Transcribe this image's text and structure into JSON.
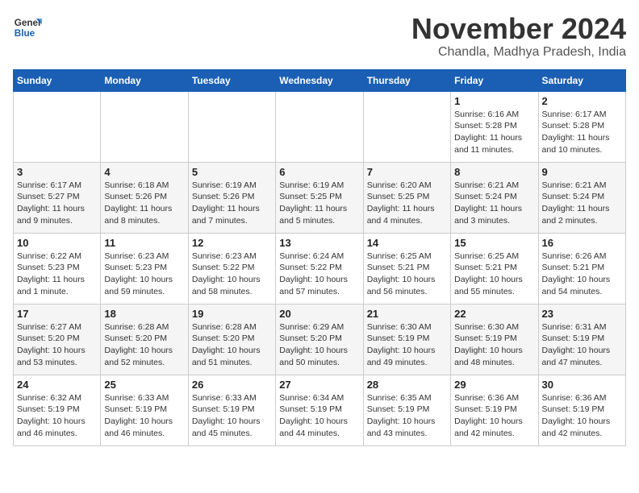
{
  "header": {
    "logo_line1": "General",
    "logo_line2": "Blue",
    "month_title": "November 2024",
    "location": "Chandla, Madhya Pradesh, India"
  },
  "days_of_week": [
    "Sunday",
    "Monday",
    "Tuesday",
    "Wednesday",
    "Thursday",
    "Friday",
    "Saturday"
  ],
  "weeks": [
    [
      {
        "day": "",
        "info": ""
      },
      {
        "day": "",
        "info": ""
      },
      {
        "day": "",
        "info": ""
      },
      {
        "day": "",
        "info": ""
      },
      {
        "day": "",
        "info": ""
      },
      {
        "day": "1",
        "info": "Sunrise: 6:16 AM\nSunset: 5:28 PM\nDaylight: 11 hours and 11 minutes."
      },
      {
        "day": "2",
        "info": "Sunrise: 6:17 AM\nSunset: 5:28 PM\nDaylight: 11 hours and 10 minutes."
      }
    ],
    [
      {
        "day": "3",
        "info": "Sunrise: 6:17 AM\nSunset: 5:27 PM\nDaylight: 11 hours and 9 minutes."
      },
      {
        "day": "4",
        "info": "Sunrise: 6:18 AM\nSunset: 5:26 PM\nDaylight: 11 hours and 8 minutes."
      },
      {
        "day": "5",
        "info": "Sunrise: 6:19 AM\nSunset: 5:26 PM\nDaylight: 11 hours and 7 minutes."
      },
      {
        "day": "6",
        "info": "Sunrise: 6:19 AM\nSunset: 5:25 PM\nDaylight: 11 hours and 5 minutes."
      },
      {
        "day": "7",
        "info": "Sunrise: 6:20 AM\nSunset: 5:25 PM\nDaylight: 11 hours and 4 minutes."
      },
      {
        "day": "8",
        "info": "Sunrise: 6:21 AM\nSunset: 5:24 PM\nDaylight: 11 hours and 3 minutes."
      },
      {
        "day": "9",
        "info": "Sunrise: 6:21 AM\nSunset: 5:24 PM\nDaylight: 11 hours and 2 minutes."
      }
    ],
    [
      {
        "day": "10",
        "info": "Sunrise: 6:22 AM\nSunset: 5:23 PM\nDaylight: 11 hours and 1 minute."
      },
      {
        "day": "11",
        "info": "Sunrise: 6:23 AM\nSunset: 5:23 PM\nDaylight: 10 hours and 59 minutes."
      },
      {
        "day": "12",
        "info": "Sunrise: 6:23 AM\nSunset: 5:22 PM\nDaylight: 10 hours and 58 minutes."
      },
      {
        "day": "13",
        "info": "Sunrise: 6:24 AM\nSunset: 5:22 PM\nDaylight: 10 hours and 57 minutes."
      },
      {
        "day": "14",
        "info": "Sunrise: 6:25 AM\nSunset: 5:21 PM\nDaylight: 10 hours and 56 minutes."
      },
      {
        "day": "15",
        "info": "Sunrise: 6:25 AM\nSunset: 5:21 PM\nDaylight: 10 hours and 55 minutes."
      },
      {
        "day": "16",
        "info": "Sunrise: 6:26 AM\nSunset: 5:21 PM\nDaylight: 10 hours and 54 minutes."
      }
    ],
    [
      {
        "day": "17",
        "info": "Sunrise: 6:27 AM\nSunset: 5:20 PM\nDaylight: 10 hours and 53 minutes."
      },
      {
        "day": "18",
        "info": "Sunrise: 6:28 AM\nSunset: 5:20 PM\nDaylight: 10 hours and 52 minutes."
      },
      {
        "day": "19",
        "info": "Sunrise: 6:28 AM\nSunset: 5:20 PM\nDaylight: 10 hours and 51 minutes."
      },
      {
        "day": "20",
        "info": "Sunrise: 6:29 AM\nSunset: 5:20 PM\nDaylight: 10 hours and 50 minutes."
      },
      {
        "day": "21",
        "info": "Sunrise: 6:30 AM\nSunset: 5:19 PM\nDaylight: 10 hours and 49 minutes."
      },
      {
        "day": "22",
        "info": "Sunrise: 6:30 AM\nSunset: 5:19 PM\nDaylight: 10 hours and 48 minutes."
      },
      {
        "day": "23",
        "info": "Sunrise: 6:31 AM\nSunset: 5:19 PM\nDaylight: 10 hours and 47 minutes."
      }
    ],
    [
      {
        "day": "24",
        "info": "Sunrise: 6:32 AM\nSunset: 5:19 PM\nDaylight: 10 hours and 46 minutes."
      },
      {
        "day": "25",
        "info": "Sunrise: 6:33 AM\nSunset: 5:19 PM\nDaylight: 10 hours and 46 minutes."
      },
      {
        "day": "26",
        "info": "Sunrise: 6:33 AM\nSunset: 5:19 PM\nDaylight: 10 hours and 45 minutes."
      },
      {
        "day": "27",
        "info": "Sunrise: 6:34 AM\nSunset: 5:19 PM\nDaylight: 10 hours and 44 minutes."
      },
      {
        "day": "28",
        "info": "Sunrise: 6:35 AM\nSunset: 5:19 PM\nDaylight: 10 hours and 43 minutes."
      },
      {
        "day": "29",
        "info": "Sunrise: 6:36 AM\nSunset: 5:19 PM\nDaylight: 10 hours and 42 minutes."
      },
      {
        "day": "30",
        "info": "Sunrise: 6:36 AM\nSunset: 5:19 PM\nDaylight: 10 hours and 42 minutes."
      }
    ]
  ]
}
